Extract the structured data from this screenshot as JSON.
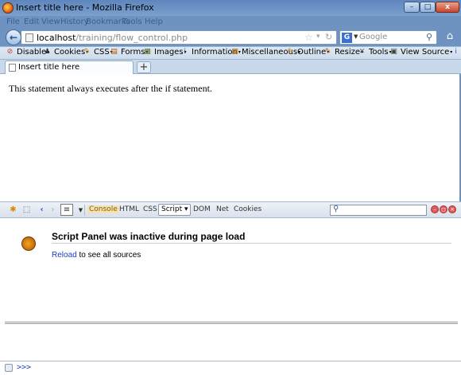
{
  "window": {
    "title": "Insert title here - Mozilla Firefox",
    "minimize": "–",
    "maximize": "□",
    "close": "x"
  },
  "menus": [
    "File",
    "Edit",
    "View",
    "History",
    "Bookmarks",
    "Tools",
    "Help"
  ],
  "nav": {
    "back_glyph": "←",
    "url_host": "localhost",
    "url_tail": "/training/flow_control.php",
    "search_placeholder": "Google",
    "search_engine_glyph": "G"
  },
  "devtoolbar": [
    {
      "label": "Disable",
      "icon": "disable-icon",
      "glyph": "⊘",
      "color": "#d23b2a"
    },
    {
      "label": "Cookies",
      "icon": "cookies-icon",
      "glyph": "♟",
      "color": "#333"
    },
    {
      "label": "CSS",
      "icon": "css-icon",
      "glyph": "✎",
      "color": "#c08a00"
    },
    {
      "label": "Forms",
      "icon": "forms-icon",
      "glyph": "▤",
      "color": "#b05a00"
    },
    {
      "label": "Images",
      "icon": "images-icon",
      "glyph": "▩",
      "color": "#5a7a3a"
    },
    {
      "label": "Information",
      "icon": "information-icon",
      "glyph": "i",
      "color": "#1f5fbf"
    },
    {
      "label": "Miscellaneous",
      "icon": "miscellaneous-icon",
      "glyph": "▦",
      "color": "#b06a10"
    },
    {
      "label": "Outline",
      "icon": "outline-icon",
      "glyph": "✎",
      "color": "#c08a00"
    },
    {
      "label": "Resize",
      "icon": "resize-icon",
      "glyph": "✎",
      "color": "#c05a00"
    },
    {
      "label": "Tools",
      "icon": "tools-icon",
      "glyph": "✕",
      "color": "#555"
    },
    {
      "label": "View Source",
      "icon": "view-source-icon",
      "glyph": "▣",
      "color": "#2f4f2f"
    },
    {
      "label": "Op",
      "icon": "options-icon",
      "glyph": "i",
      "color": "#1f5fbf"
    }
  ],
  "tab": {
    "title": "Insert title here",
    "new_tab_glyph": "+"
  },
  "page": {
    "text": "This statement always executes after the if statement."
  },
  "firebug": {
    "tabs": {
      "console": "Console",
      "html": "HTML",
      "css": "CSS",
      "script": "Script ▾",
      "dom": "DOM",
      "net": "Net",
      "cookies": "Cookies"
    },
    "panel_title": "Script Panel was inactive during page load",
    "reload_link": "Reload",
    "reload_rest": " to see all sources",
    "command_prompt": ">>>"
  }
}
